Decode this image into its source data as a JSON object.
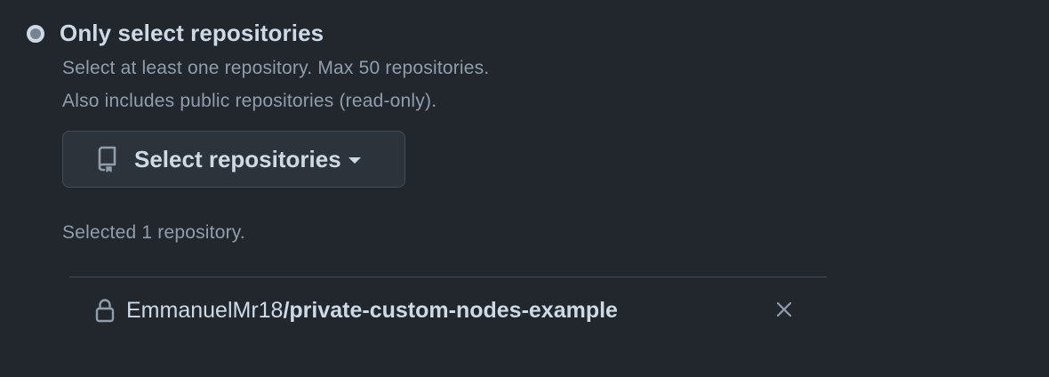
{
  "access_option": {
    "label": "Only select repositories",
    "selected": true,
    "description_lines": [
      "Select at least one repository. Max 50 repositories.",
      "Also includes public repositories (read-only)."
    ]
  },
  "select_button": {
    "icon": "repo-icon",
    "label": "Select repositories",
    "caret_icon": "triangle-down-icon"
  },
  "selection_summary": "Selected 1 repository.",
  "selected_repositories": [
    {
      "icon": "lock-icon",
      "owner": "EmmanuelMr18",
      "separator": "/",
      "name": "private-custom-nodes-example",
      "remove_icon": "x-icon"
    }
  ],
  "colors": {
    "background": "#22272e",
    "text_primary": "#cdd9e5",
    "text_muted": "#909dab",
    "button_bg": "#2d333b",
    "border": "#444c56"
  }
}
